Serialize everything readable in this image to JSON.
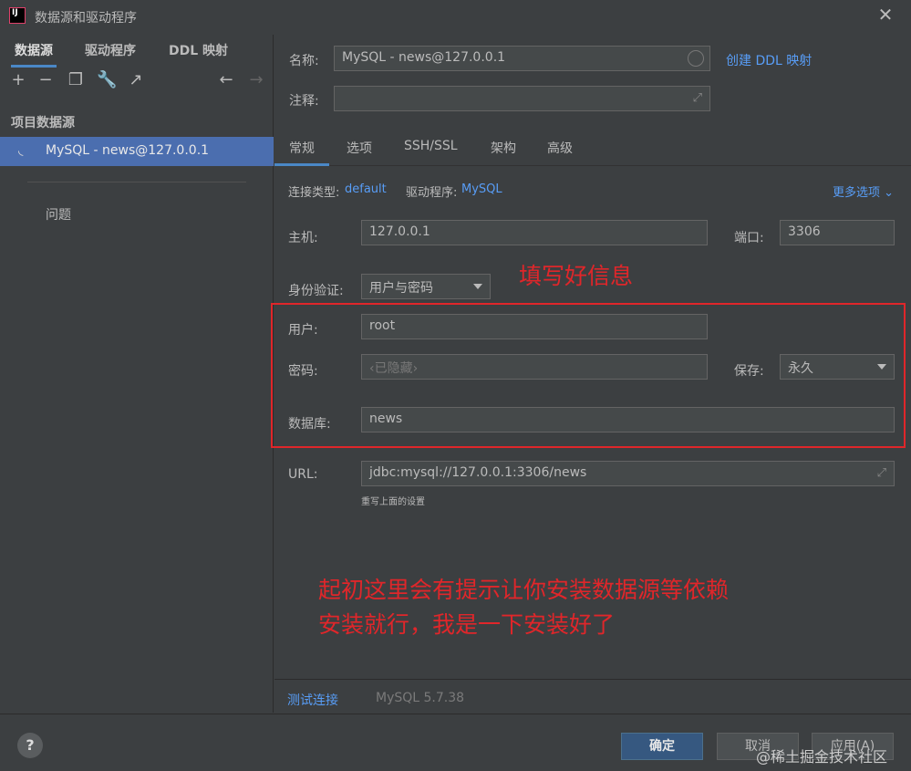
{
  "window": {
    "title": "数据源和驱动程序"
  },
  "sidebar": {
    "tabs": [
      "数据源",
      "驱动程序",
      "DDL 映射"
    ],
    "section": "项目数据源",
    "datasource": "MySQL - news@127.0.0.1",
    "problems": "问题"
  },
  "form": {
    "name_label": "名称:",
    "name_value": "MySQL - news@127.0.0.1",
    "create_ddl": "创建 DDL 映射",
    "comment_label": "注释:",
    "tabs": [
      "常规",
      "选项",
      "SSH/SSL",
      "架构",
      "高级"
    ],
    "conn_type_label": "连接类型:",
    "conn_type_value": "default",
    "driver_label": "驱动程序:",
    "driver_value": "MySQL",
    "more_options": "更多选项",
    "host_label": "主机:",
    "host_value": "127.0.0.1",
    "port_label": "端口:",
    "port_value": "3306",
    "auth_label": "身份验证:",
    "auth_value": "用户与密码",
    "user_label": "用户:",
    "user_value": "root",
    "password_label": "密码:",
    "password_value": "‹已隐藏›",
    "save_label": "保存:",
    "save_value": "永久",
    "db_label": "数据库:",
    "db_value": "news",
    "url_label": "URL:",
    "url_value": "jdbc:mysql://127.0.0.1:3306/news",
    "url_hint": "重写上面的设置",
    "test_connection": "测试连接",
    "version": "MySQL 5.7.38"
  },
  "annotations": {
    "fill_info": "填写好信息",
    "install_line1": "起初这里会有提示让你安装数据源等依赖",
    "install_line2": "安装就行，我是一下安装好了"
  },
  "footer": {
    "help": "?",
    "ok": "确定",
    "cancel": "取消",
    "apply": "应用(A)",
    "watermark": "@稀土掘金技术社区"
  }
}
